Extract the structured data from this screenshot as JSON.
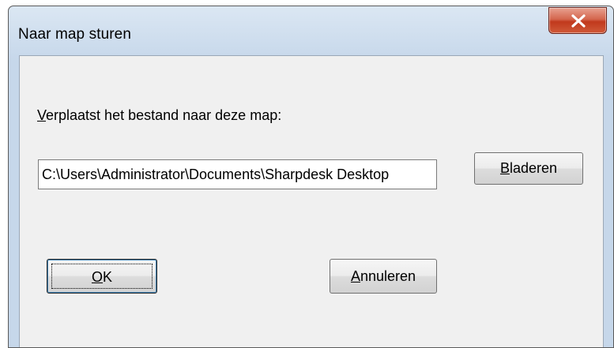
{
  "window": {
    "title": "Naar map sturen"
  },
  "dialog": {
    "label_mnemonic": "V",
    "label_rest": "erplaatst het bestand naar deze map:",
    "path_value": "C:\\Users\\Administrator\\Documents\\Sharpdesk Desktop",
    "browse_mnemonic": "B",
    "browse_rest": "laderen",
    "ok_mnemonic": "O",
    "ok_rest": "K",
    "cancel_mnemonic": "A",
    "cancel_rest": "nnuleren"
  },
  "icons": {
    "close": "close-icon"
  },
  "colors": {
    "close_button": "#c1391c",
    "client_background": "#f0f0f0",
    "frame": "#cfdeee"
  }
}
